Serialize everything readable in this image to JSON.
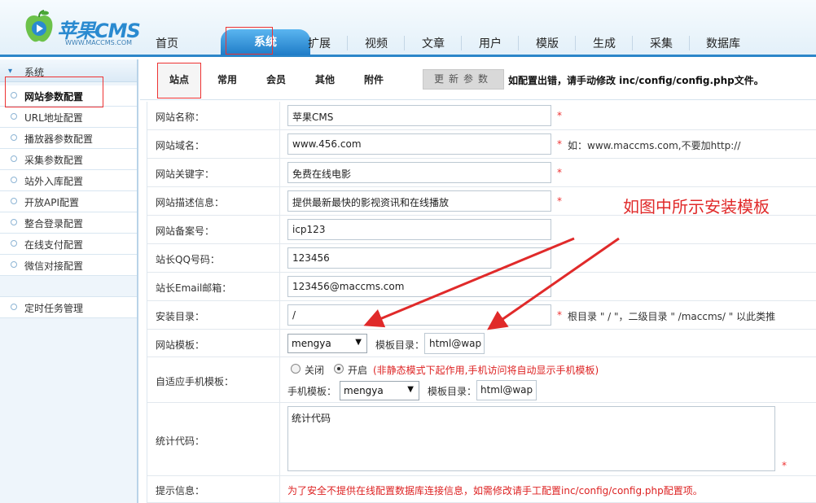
{
  "logo": {
    "text": "苹果CMS",
    "sub": "WWW.MACCMS.COM"
  },
  "nav": {
    "active": "系统",
    "items": [
      "首页",
      "扩展",
      "视频",
      "文章",
      "用户",
      "模版",
      "生成",
      "采集",
      "数据库"
    ]
  },
  "sidebar": {
    "header": "系统",
    "items": [
      "网站参数配置",
      "URL地址配置",
      "播放器参数配置",
      "采集参数配置",
      "站外入库配置",
      "开放API配置",
      "整合登录配置",
      "在线支付配置",
      "微信对接配置"
    ],
    "bottom_item": "定时任务管理"
  },
  "tabs": {
    "items": [
      "站点",
      "常用",
      "会员",
      "其他",
      "附件"
    ],
    "refresh_label": "更新参数",
    "note": "如配置出错，请手动修改 inc/config/config.php文件。"
  },
  "form": {
    "site_name": {
      "label": "网站名称：",
      "value": "苹果CMS"
    },
    "domain": {
      "label": "网站域名：",
      "value": "www.456.com",
      "hint": "如：www.maccms.com,不要加http://"
    },
    "keywords": {
      "label": "网站关键字：",
      "value": "免费在线电影"
    },
    "description": {
      "label": "网站描述信息：",
      "value": "提供最新最快的影视资讯和在线播放"
    },
    "icp": {
      "label": "网站备案号：",
      "value": "icp123"
    },
    "qq": {
      "label": "站长QQ号码：",
      "value": "123456"
    },
    "email": {
      "label": "站长Email邮箱：",
      "value": "123456@maccms.com"
    },
    "install_dir": {
      "label": "安装目录：",
      "value": "/",
      "hint": "根目录 \" / \"，二级目录 \" /maccms/ \" 以此类推"
    },
    "template": {
      "label": "网站模板：",
      "value": "mengya",
      "dir_label": "模板目录：",
      "dir_value": "html@wap"
    },
    "mobile": {
      "label": "自适应手机模板：",
      "off_label": "关闭",
      "on_label": "开启",
      "note": "(非静态模式下起作用,手机访问将自动显示手机模板)",
      "tpl_label": "手机模板：",
      "tpl_value": "mengya",
      "dir_label": "模板目录：",
      "dir_value": "html@wap"
    },
    "stats": {
      "label": "统计代码：",
      "value": "统计代码"
    },
    "tip": {
      "label": "提示信息：",
      "value": "为了安全不提供在线配置数据库连接信息，如需修改请手工配置inc/config/config.php配置项。"
    },
    "required_mark": "*"
  },
  "annotation": "如图中所示安装模板",
  "colors": {
    "accent": "#2c86c9",
    "highlight": "#e33333"
  }
}
